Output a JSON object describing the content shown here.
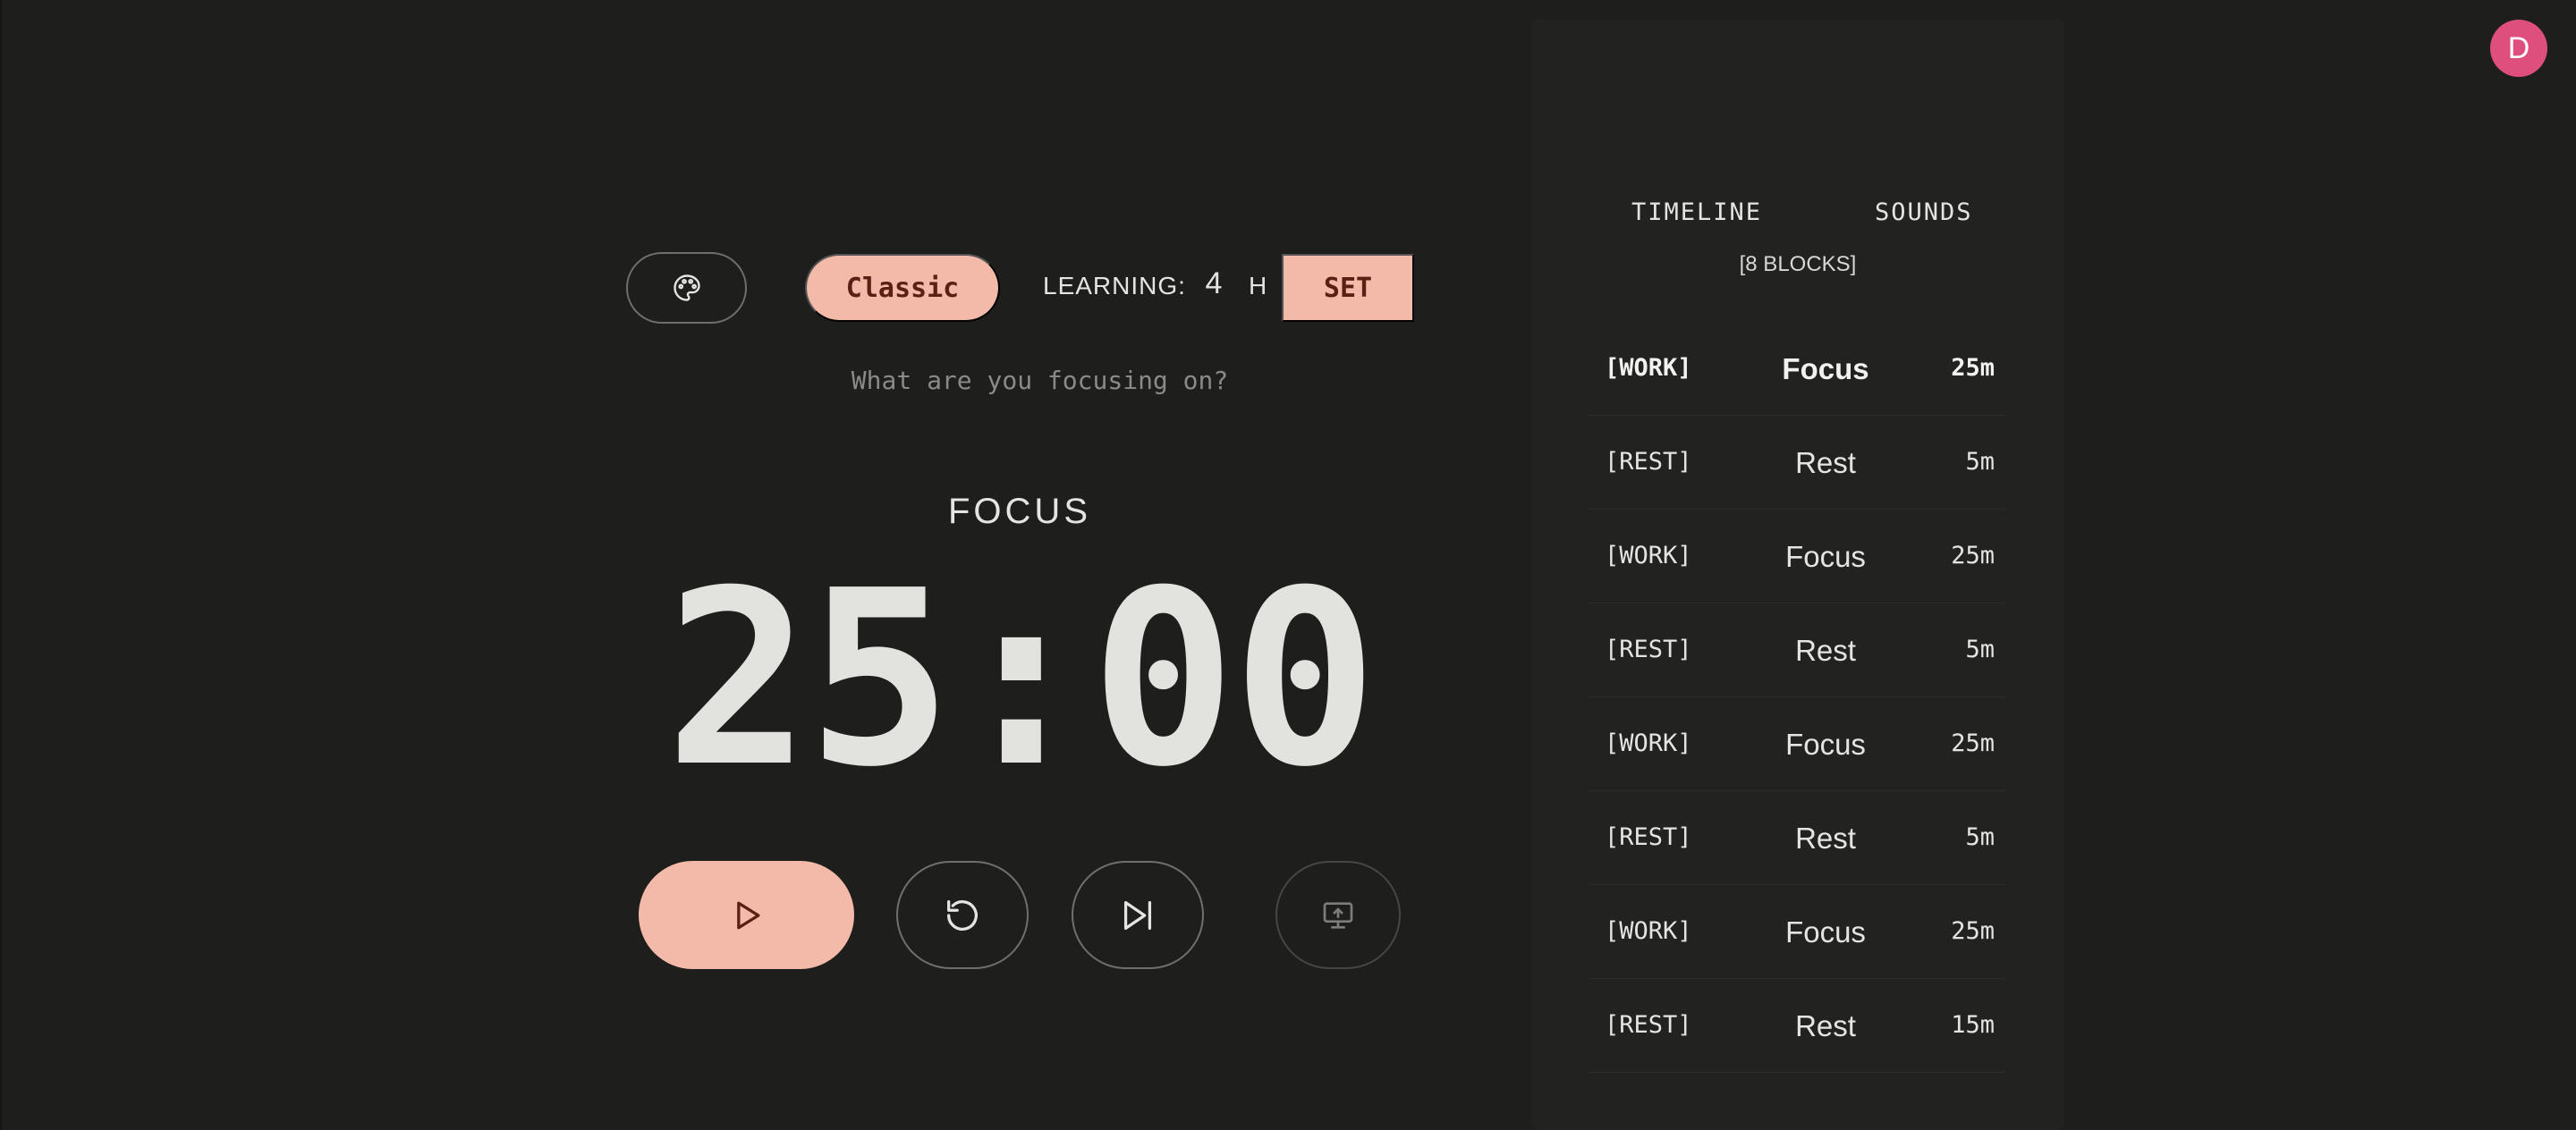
{
  "header": {
    "mode_label": "Classic",
    "learning_label": "LEARNING:",
    "hours_value": "4",
    "hours_unit": "H",
    "set_label": "SET"
  },
  "task": {
    "placeholder": "What are you focusing on?"
  },
  "timer": {
    "phase": "FOCUS",
    "time": "25:00"
  },
  "icons": {
    "palette": "palette-icon",
    "play": "play-icon",
    "reset": "reset-icon",
    "skip": "skip-forward-icon",
    "screen": "screen-share-icon"
  },
  "sidebar": {
    "tabs": [
      {
        "label": "TIMELINE"
      },
      {
        "label": "SOUNDS"
      }
    ],
    "block_count": "[8 BLOCKS]",
    "blocks": [
      {
        "type": "[WORK]",
        "name": "Focus",
        "duration": "25m",
        "active": true
      },
      {
        "type": "[REST]",
        "name": "Rest",
        "duration": "5m",
        "active": false
      },
      {
        "type": "[WORK]",
        "name": "Focus",
        "duration": "25m",
        "active": false
      },
      {
        "type": "[REST]",
        "name": "Rest",
        "duration": "5m",
        "active": false
      },
      {
        "type": "[WORK]",
        "name": "Focus",
        "duration": "25m",
        "active": false
      },
      {
        "type": "[REST]",
        "name": "Rest",
        "duration": "5m",
        "active": false
      },
      {
        "type": "[WORK]",
        "name": "Focus",
        "duration": "25m",
        "active": false
      },
      {
        "type": "[REST]",
        "name": "Rest",
        "duration": "15m",
        "active": false
      }
    ]
  },
  "user": {
    "avatar_initial": "D"
  },
  "colors": {
    "background": "#1e1f1d",
    "sidebar": "#222321",
    "accent": "#f3b9a9",
    "accent_text": "#5c1f14",
    "avatar": "#de4f7e"
  }
}
